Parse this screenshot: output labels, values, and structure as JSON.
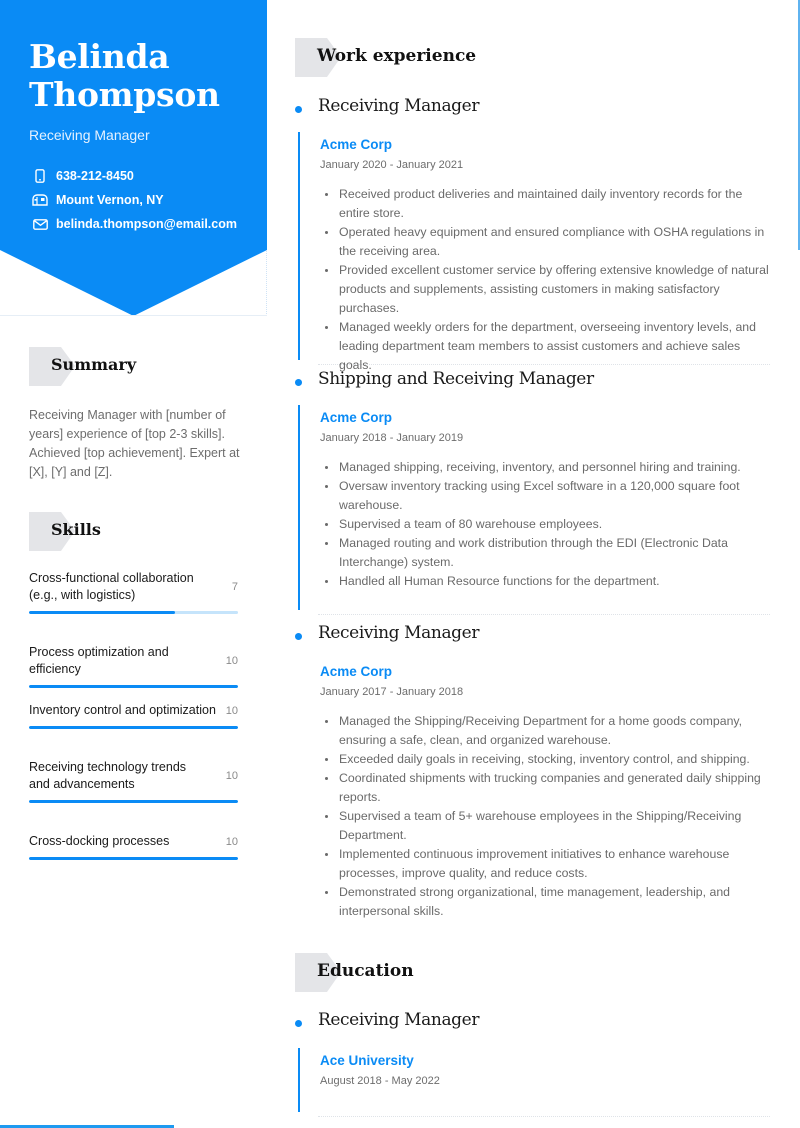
{
  "profile": {
    "name": "Belinda Thompson",
    "role": "Receiving Manager",
    "contacts": [
      {
        "icon": "phone-icon",
        "text": "638-212-8450"
      },
      {
        "icon": "mailbox-icon",
        "text": "Mount Vernon, NY"
      },
      {
        "icon": "envelope-icon",
        "text": "belinda.thompson@email.com"
      }
    ]
  },
  "summary": {
    "heading": "Summary",
    "text": "Receiving Manager with [number of years] experience of [top 2-3 skills]. Achieved [top achievement]. Expert at [X], [Y] and [Z]."
  },
  "skills": {
    "heading": "Skills",
    "max_level": 10,
    "items": [
      {
        "name": "Cross-functional collaboration (e.g., with logistics)",
        "level": 7
      },
      {
        "name": "Process optimization and efficiency",
        "level": 10
      },
      {
        "name": "Inventory control and optimization",
        "level": 10
      },
      {
        "name": "Receiving technology trends and advancements",
        "level": 10
      },
      {
        "name": "Cross-docking processes",
        "level": 10
      }
    ]
  },
  "work": {
    "heading": "Work experience",
    "entries": [
      {
        "title": "Receiving Manager",
        "company": "Acme Corp",
        "dates": "January 2020 - January 2021",
        "bullets": [
          "Received product deliveries and maintained daily inventory records for the entire store.",
          "Operated heavy equipment and ensured compliance with OSHA regulations in the receiving area.",
          "Provided excellent customer service by offering extensive knowledge of natural products and supplements, assisting customers in making satisfactory purchases.",
          "Managed weekly orders for the department, overseeing inventory levels, and leading department team members to assist customers and achieve sales goals."
        ]
      },
      {
        "title": "Shipping and Receiving Manager",
        "company": "Acme Corp",
        "dates": "January 2018 - January 2019",
        "bullets": [
          "Managed shipping, receiving, inventory, and personnel hiring and training.",
          "Oversaw inventory tracking using Excel software in a 120,000 square foot warehouse.",
          "Supervised a team of 80 warehouse employees.",
          "Managed routing and work distribution through the EDI (Electronic Data Interchange) system.",
          "Handled all Human Resource functions for the department."
        ]
      },
      {
        "title": "Receiving Manager",
        "company": "Acme Corp",
        "dates": "January 2017 - January 2018",
        "bullets": [
          "Managed the Shipping/Receiving Department for a home goods company, ensuring a safe, clean, and organized warehouse.",
          "Exceeded daily goals in receiving, stocking, inventory control, and shipping.",
          "Coordinated shipments with trucking companies and generated daily shipping reports.",
          "Supervised a team of 5+ warehouse employees in the Shipping/Receiving Department.",
          "Implemented continuous improvement initiatives to enhance warehouse processes, improve quality, and reduce costs.",
          "Demonstrated strong organizational, time management, leadership, and interpersonal skills."
        ]
      }
    ]
  },
  "education": {
    "heading": "Education",
    "entries": [
      {
        "title": "Receiving Manager",
        "school": "Ace University",
        "dates": "August 2018 - May 2022"
      }
    ]
  },
  "colors": {
    "accent": "#0a8bf5",
    "accent_light": "#c5e4fb",
    "heading_tab": "#e4e5e8"
  }
}
